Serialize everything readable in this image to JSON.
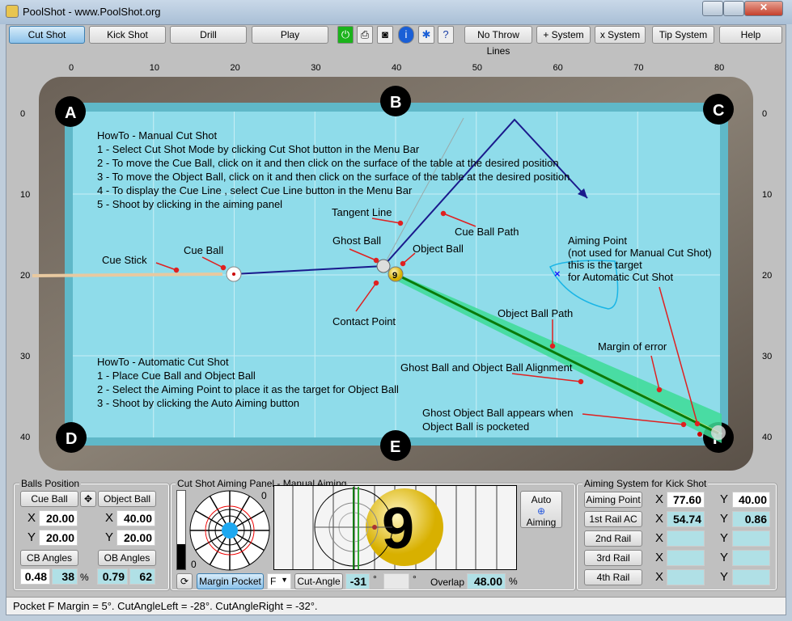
{
  "window": {
    "title": "PoolShot - www.PoolShot.org"
  },
  "toolbar": {
    "buttons": [
      "Cut Shot",
      "Kick Shot",
      "Drill",
      "Play"
    ],
    "icons": [
      "power-icon",
      "print-icon",
      "camera-icon",
      "info-icon",
      "settings-icon",
      "help-document-icon"
    ],
    "buttons2": [
      "No Throw Lines",
      "+ System",
      "x System",
      "Tip System",
      "Help"
    ]
  },
  "table": {
    "x_ticks": [
      "0",
      "10",
      "20",
      "30",
      "40",
      "50",
      "60",
      "70",
      "80"
    ],
    "y_ticks": [
      "0",
      "10",
      "20",
      "30",
      "40"
    ],
    "pockets": [
      "A",
      "B",
      "C",
      "D",
      "E",
      "F"
    ],
    "object_ball_number": "9",
    "howto_manual": [
      "HowTo - Manual Cut Shot",
      "1 - Select Cut Shot Mode by clicking Cut Shot button in the Menu Bar",
      "2 - To move the Cue Ball, click on it and then click on the surface of the table at the desired position",
      "3 - To move the Object Ball, click on it and then click on the surface of the table at the desired position",
      "4 - To display the Cue Line , select Cue Line button in the Menu Bar",
      "5 - Shoot by clicking in the aiming panel"
    ],
    "howto_auto": [
      "HowTo - Automatic Cut Shot",
      "1 - Place Cue Ball and Object Ball",
      "2 - Select the Aiming Point to place it as the target for Object Ball",
      "3 - Shoot by clicking the Auto Aiming button"
    ],
    "annotations": {
      "cue_stick": "Cue Stick",
      "cue_ball": "Cue Ball",
      "tangent_line": "Tangent Line",
      "ghost_ball": "Ghost Ball",
      "object_ball": "Object Ball",
      "cue_ball_path": "Cue Ball Path",
      "contact_point": "Contact Point",
      "aiming_point": [
        "Aiming Point",
        "(not used for Manual Cut Shot)",
        "this is the target",
        "for Automatic Cut Shot"
      ],
      "object_ball_path": "Object Ball Path",
      "margin_of_error": "Margin of error",
      "alignment": "Ghost Ball and Object Ball Alignment",
      "ghost_object_ball": [
        "Ghost Object Ball appears when",
        "Object Ball is pocketed"
      ]
    },
    "colors": {
      "felt": "#8fdcea",
      "cue_path": "#1a1a8c",
      "object_path": "#0a7a0a",
      "margin": "#3ddc97",
      "annotation": "#e02020",
      "aiming_shape": "#19b5e6"
    }
  },
  "balls_position": {
    "title": "Balls Position",
    "cue_ball": "Cue Ball",
    "object_ball": "Object Ball",
    "x_label": "X",
    "y_label": "Y",
    "cb_x": "20.00",
    "cb_y": "20.00",
    "ob_x": "40.00",
    "ob_y": "20.00",
    "cb_angles": "CB Angles",
    "ob_angles": "OB Angles",
    "cb_val1": "0.48",
    "cb_val2": "38",
    "pct": "%",
    "ob_val1": "0.79",
    "ob_val2": "62"
  },
  "aiming_panel": {
    "title": "Cut Shot Aiming Panel - Manual Aiming",
    "scale_top": "0",
    "scale_bottom": "0",
    "margin_pocket": "Margin Pocket",
    "pocket_select": "F",
    "cut_angle": "Cut-Angle",
    "cut_angle_value": "-31",
    "deg": "°",
    "overlap_label": "Overlap",
    "overlap_value": "48.00",
    "pct": "%",
    "auto_aiming": [
      "Auto",
      "Aiming"
    ],
    "ball_number": "9"
  },
  "kick_system": {
    "title": "Aiming System for Kick Shot",
    "rows": [
      {
        "label": "Aiming Point",
        "x": "77.60",
        "y": "40.00"
      },
      {
        "label": "1st Rail AC",
        "x": "54.74",
        "y": "0.86"
      },
      {
        "label": "2nd Rail",
        "x": "",
        "y": ""
      },
      {
        "label": "3rd Rail",
        "x": "",
        "y": ""
      },
      {
        "label": "4th Rail",
        "x": "",
        "y": ""
      }
    ],
    "x_label": "X",
    "y_label": "Y"
  },
  "status": "Pocket F Margin = 5°.   CutAngleLeft = -28°.   CutAngleRight = -32°."
}
